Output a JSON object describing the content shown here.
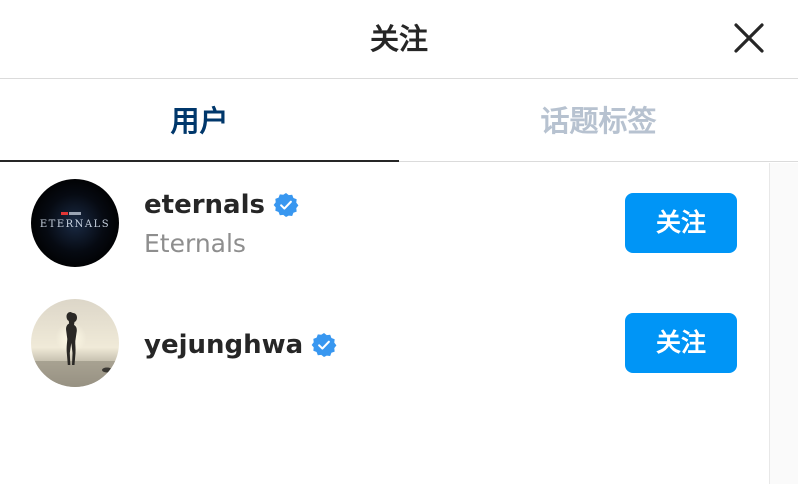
{
  "dialog": {
    "title": "关注",
    "close_icon": "close-icon"
  },
  "tabs": [
    {
      "label": "用户",
      "active": true
    },
    {
      "label": "话题标签",
      "active": false
    }
  ],
  "users": [
    {
      "username": "eternals",
      "verified": true,
      "full_name": "Eternals",
      "avatar_text": "ETERNALS",
      "avatar_badge": "MARVEL STUDIOS",
      "follow_label": "关注"
    },
    {
      "username": "yejunghwa",
      "verified": true,
      "full_name": "",
      "follow_label": "关注"
    }
  ],
  "colors": {
    "follow_button": "#0095f6",
    "verified_badge": "#3897f0",
    "active_tab": "#00376b",
    "inactive_tab": "#b7c2d0"
  }
}
